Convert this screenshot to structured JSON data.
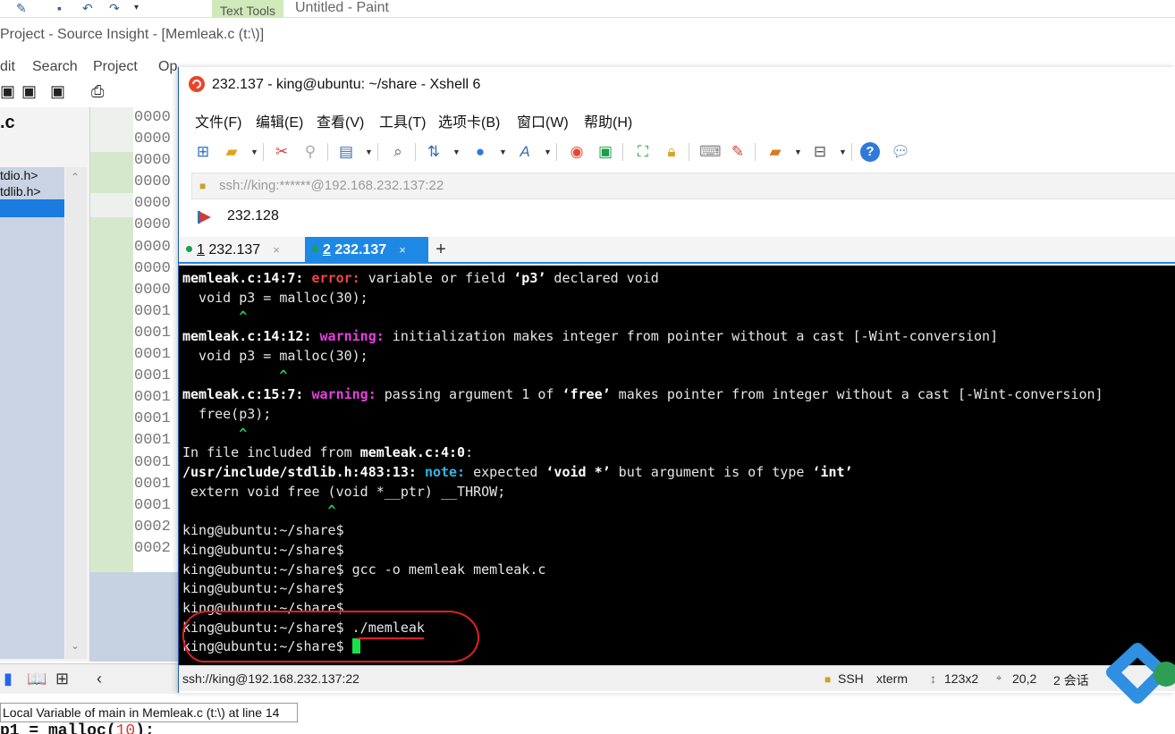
{
  "paint": {
    "text_tools_tab": "Text Tools",
    "title": "Untitled - Paint"
  },
  "source_insight": {
    "title": "Project - Source Insight - [Memleak.c (t:\\)]",
    "menu": [
      "dit",
      "Search",
      "Project",
      "Op"
    ],
    "file_heading": ".c",
    "file_list": [
      "tdio.h>",
      "tdlib.h>"
    ],
    "line_numbers": [
      "0000",
      "0000",
      "0000",
      "0000",
      "0000",
      "0000",
      "0000",
      "0000",
      "0000",
      "0001",
      "0001",
      "0001",
      "0001",
      "0001",
      "0001",
      "0001",
      "0001",
      "0001",
      "0001",
      "0002",
      "0002"
    ],
    "status": "Local Variable of main in Memleak.c (t:\\) at line 14",
    "code_fragment": "p1 = malloc(",
    "code_number": "10",
    "code_tail": ");"
  },
  "xshell": {
    "title": "232.137 - king@ubuntu: ~/share - Xshell 6",
    "menu": [
      "文件(F)",
      "编辑(E)",
      "查看(V)",
      "工具(T)",
      "选项卡(B)",
      "窗口(W)",
      "帮助(H)"
    ],
    "address": "ssh://king:******@192.168.232.137:22",
    "session_label": "232.128",
    "tabs": [
      {
        "num": "1",
        "label": " 232.137",
        "close": "×"
      },
      {
        "num": "2",
        "label": " 232.137",
        "close": "×"
      }
    ],
    "tab_add": "+",
    "terminal": {
      "l1_loc": "memleak.c:14:7:",
      "l1_kind": "error:",
      "l1_msg_a": " variable or field ",
      "l1_q": "‘p3’",
      "l1_msg_b": " declared void",
      "l2": "  void p3 = malloc(30);",
      "l3": "       ^",
      "l4_loc": "memleak.c:14:12:",
      "l4_kind": "warning:",
      "l4_msg": " initialization makes integer from pointer without a cast [-Wint-conversion]",
      "l5": "  void p3 = malloc(30);",
      "l6": "            ^",
      "l7_loc": "memleak.c:15:7:",
      "l7_kind": "warning:",
      "l7_msg_a": " passing argument 1 of ",
      "l7_q": "‘free’",
      "l7_msg_b": " makes pointer from integer without a cast [-Wint-conversion]",
      "l8": "  free(p3);",
      "l9": "       ^",
      "l10_a": "In file included from ",
      "l10_b": "memleak.c:4:0",
      "l10_c": ":",
      "l11_loc": "/usr/include/stdlib.h:483:13:",
      "l11_kind": "note:",
      "l11_msg_a": " expected ",
      "l11_q1": "‘void *’",
      "l11_msg_b": " but argument is of type ",
      "l11_q2": "‘int’",
      "l12": " extern void free (void *__ptr) __THROW;",
      "l13": "                  ^",
      "l14": "king@ubuntu:~/share$",
      "l15": "king@ubuntu:~/share$",
      "l16": "king@ubuntu:~/share$ gcc -o memleak memleak.c",
      "l17": "king@ubuntu:~/share$",
      "l18": "king@ubuntu:~/share$",
      "l19": "king@ubuntu:~/share$ ./memleak",
      "l20": "king@ubuntu:~/share$ "
    },
    "status": {
      "address": "ssh://king@192.168.232.137:22",
      "protocol": "SSH",
      "term": "xterm",
      "size": "123x2",
      "position": "20,2",
      "sessions": "2 会话"
    }
  },
  "colors": {
    "accent": "#1e88e5",
    "terminal_bg": "#000000",
    "error": "#ef4444",
    "warning": "#e83fe0",
    "note": "#2fb7e6",
    "cursor": "#18e048",
    "annotation": "#e02020"
  }
}
